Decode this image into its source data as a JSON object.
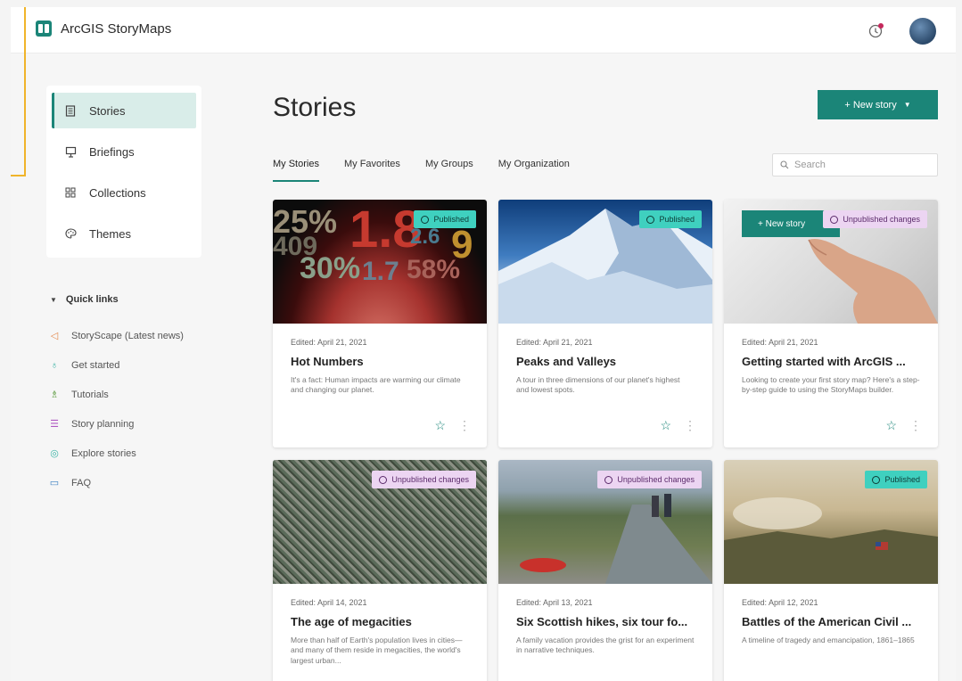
{
  "app": {
    "name": "ArcGIS StoryMaps"
  },
  "colors": {
    "accent": "#1b8578",
    "published_badge": "#3fd0bf",
    "unpublished_badge": "#ecd5f2",
    "highlight_frame": "#f0b42a"
  },
  "sidebar": {
    "items": [
      {
        "label": "Stories",
        "icon": "document-icon",
        "active": true
      },
      {
        "label": "Briefings",
        "icon": "presentation-icon",
        "active": false
      },
      {
        "label": "Collections",
        "icon": "grid-icon",
        "active": false
      },
      {
        "label": "Themes",
        "icon": "palette-icon",
        "active": false
      }
    ]
  },
  "quick_links": {
    "heading": "Quick links",
    "items": [
      {
        "label": "StoryScape (Latest news)",
        "icon": "megaphone-icon"
      },
      {
        "label": "Get started",
        "icon": "lightbulb-icon"
      },
      {
        "label": "Tutorials",
        "icon": "book-icon"
      },
      {
        "label": "Story planning",
        "icon": "checklist-icon"
      },
      {
        "label": "Explore stories",
        "icon": "compass-icon"
      },
      {
        "label": "FAQ",
        "icon": "chat-icon"
      }
    ]
  },
  "main": {
    "title": "Stories",
    "new_story_label": "+ New story",
    "tabs": [
      {
        "label": "My Stories",
        "active": true
      },
      {
        "label": "My Favorites",
        "active": false
      },
      {
        "label": "My Groups",
        "active": false
      },
      {
        "label": "My Organization",
        "active": false
      }
    ],
    "search_placeholder": "Search"
  },
  "cards": [
    {
      "status": "Published",
      "edited": "Edited: April 21, 2021",
      "title": "Hot Numbers",
      "description": "It's a fact: Human impacts are warming our climate and changing our planet.",
      "image_numbers": [
        "25%",
        "1.8",
        "409",
        "2.6",
        "9",
        "30%",
        "1.7",
        "58%"
      ]
    },
    {
      "status": "Published",
      "edited": "Edited: April 21, 2021",
      "title": "Peaks and Valleys",
      "description": "A tour in three dimensions of our planet's highest and lowest spots."
    },
    {
      "status": "Unpublished changes",
      "edited": "Edited: April 21, 2021",
      "title": "Getting started with ArcGIS ...",
      "description": "Looking to create your first story map? Here's a step-by-step guide to using the StoryMaps builder.",
      "image_button_label": "+ New story"
    },
    {
      "status": "Unpublished changes",
      "edited": "Edited: April 14, 2021",
      "title": "The age of megacities",
      "description": "More than half of Earth's population lives in cities—and many of them reside in megacities, the world's largest urban..."
    },
    {
      "status": "Unpublished changes",
      "edited": "Edited: April 13, 2021",
      "title": "Six Scottish hikes, six tour fo...",
      "description": "A family vacation provides the grist for an experiment in narrative techniques."
    },
    {
      "status": "Published",
      "edited": "Edited: April 12, 2021",
      "title": "Battles of the American Civil ...",
      "description": "A timeline of tragedy and emancipation, 1861–1865"
    }
  ]
}
